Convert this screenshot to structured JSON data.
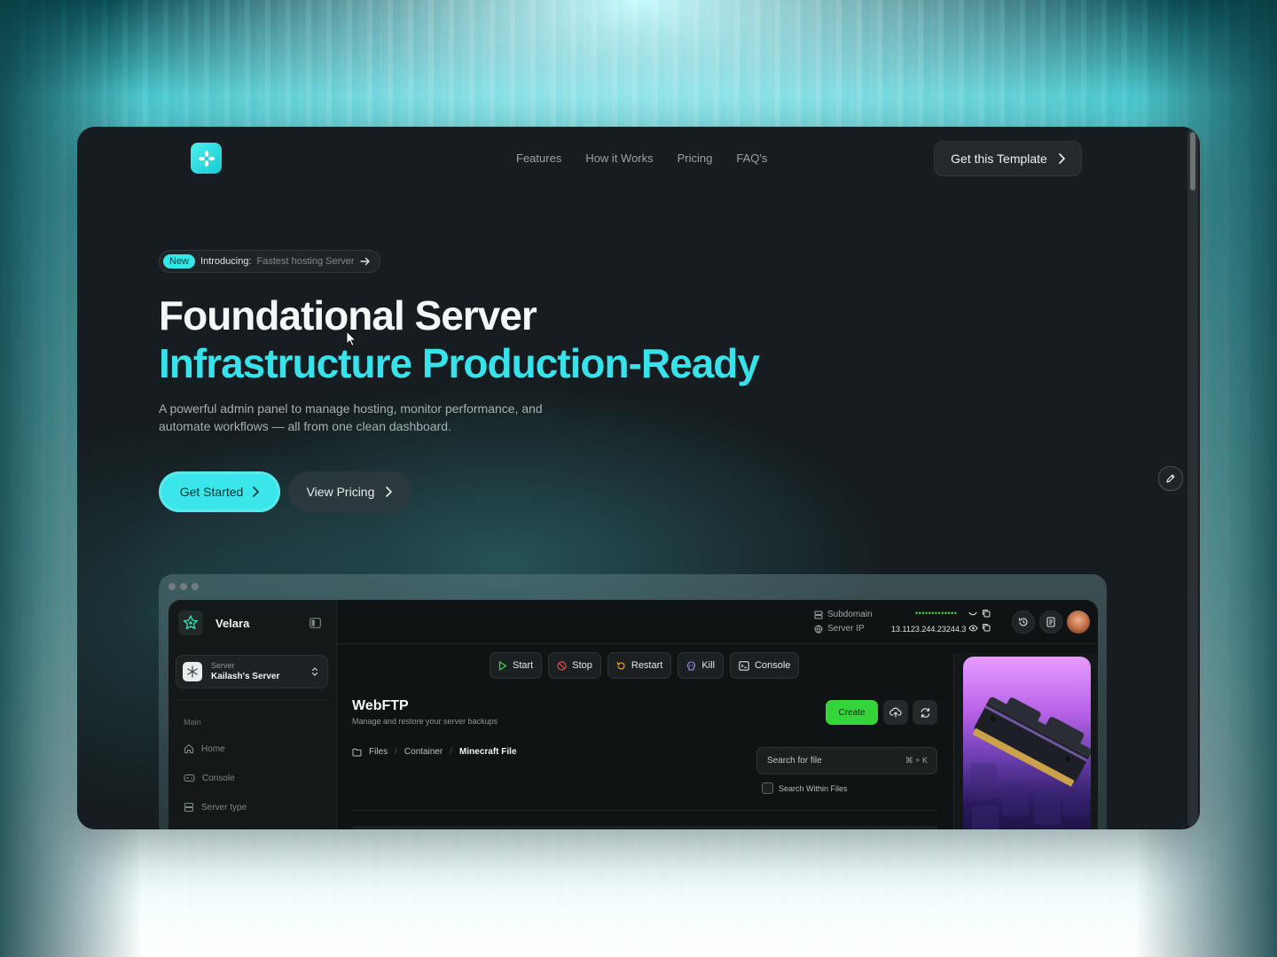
{
  "nav": {
    "links": [
      "Features",
      "How it Works",
      "Pricing",
      "FAQ's"
    ],
    "cta": "Get this Template"
  },
  "hero": {
    "badge_new": "New",
    "badge_intro": "Introducing:",
    "badge_text": "Fastest hosting Server",
    "title_line1": "Foundational Server",
    "title_line2": "Infrastructure Production-Ready",
    "subtitle": "A powerful admin panel to manage hosting, monitor performance, and automate workflows — all from one clean dashboard.",
    "primary_button": "Get Started",
    "secondary_button": "View Pricing"
  },
  "app": {
    "name": "Velara",
    "server_label": "Server",
    "server_name": "Kailash's Server",
    "section_main": "Main",
    "menu": [
      "Home",
      "Console",
      "Server type"
    ],
    "subdomain_label": "Subdomain",
    "subdomain_value": "•••••••••••••",
    "ip_label": "Server IP",
    "ip_value": "13.1123.244.23244.3",
    "actions": [
      "Start",
      "Stop",
      "Restart",
      "Kill",
      "Console"
    ],
    "page_title": "WebFTP",
    "page_sub": "Manage and restore your server backups",
    "create_button": "Create",
    "breadcrumbs": [
      "Files",
      "Container",
      "Minecraft File"
    ],
    "search_placeholder": "Search for file",
    "search_shortcut": "⌘ + K",
    "search_within": "Search Within Files"
  },
  "colors": {
    "accent": "#37e2ea",
    "success": "#35d43b",
    "background": "#161c1f"
  }
}
